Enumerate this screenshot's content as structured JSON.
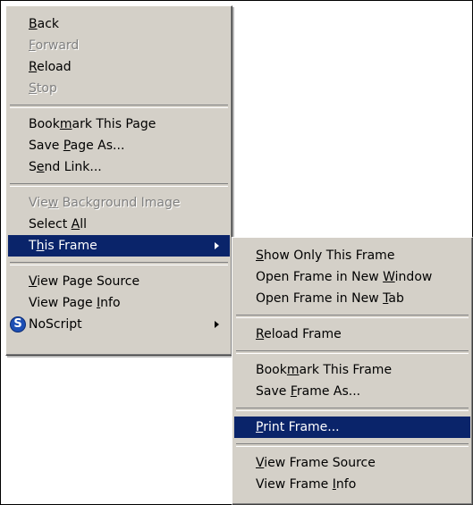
{
  "main_menu": {
    "items": [
      {
        "pre": "",
        "key": "B",
        "post": "ack",
        "disabled": false
      },
      {
        "pre": "",
        "key": "F",
        "post": "orward",
        "disabled": true
      },
      {
        "pre": "",
        "key": "R",
        "post": "eload",
        "disabled": false
      },
      {
        "pre": "",
        "key": "S",
        "post": "top",
        "disabled": true
      },
      {
        "pre": "Book",
        "key": "m",
        "post": "ark This Page",
        "disabled": false
      },
      {
        "pre": "Save ",
        "key": "P",
        "post": "age As...",
        "disabled": false
      },
      {
        "pre": "S",
        "key": "e",
        "post": "nd Link...",
        "disabled": false
      },
      {
        "pre": "Vie",
        "key": "w",
        "post": " Background Image",
        "disabled": true
      },
      {
        "pre": "Select ",
        "key": "A",
        "post": "ll",
        "disabled": false
      },
      {
        "pre": "T",
        "key": "h",
        "post": "is Frame",
        "disabled": false,
        "highlighted": true,
        "has_submenu": true
      },
      {
        "pre": "",
        "key": "V",
        "post": "iew Page Source",
        "disabled": false
      },
      {
        "pre": "View Page ",
        "key": "I",
        "post": "nfo",
        "disabled": false
      },
      {
        "pre": "NoScript",
        "key": "",
        "post": "",
        "disabled": false,
        "icon": "noscript-icon",
        "icon_letter": "S",
        "has_submenu": true
      }
    ]
  },
  "frame_submenu": {
    "items": [
      {
        "pre": "",
        "key": "S",
        "post": "how Only This Frame"
      },
      {
        "pre": "Open Frame in New ",
        "key": "W",
        "post": "indow"
      },
      {
        "pre": "Open Frame in New ",
        "key": "T",
        "post": "ab"
      },
      {
        "pre": "",
        "key": "R",
        "post": "eload Frame"
      },
      {
        "pre": "Book",
        "key": "m",
        "post": "ark This Frame"
      },
      {
        "pre": "Save ",
        "key": "F",
        "post": "rame As..."
      },
      {
        "pre": "",
        "key": "P",
        "post": "rint Frame...",
        "highlighted": true
      },
      {
        "pre": "",
        "key": "V",
        "post": "iew Frame Source"
      },
      {
        "pre": "View Frame ",
        "key": "I",
        "post": "nfo"
      }
    ]
  },
  "colors": {
    "menu_background": "#d4d0c8",
    "highlight": "#0a246a",
    "highlight_text": "#ffffff",
    "disabled_text": "#808080"
  }
}
